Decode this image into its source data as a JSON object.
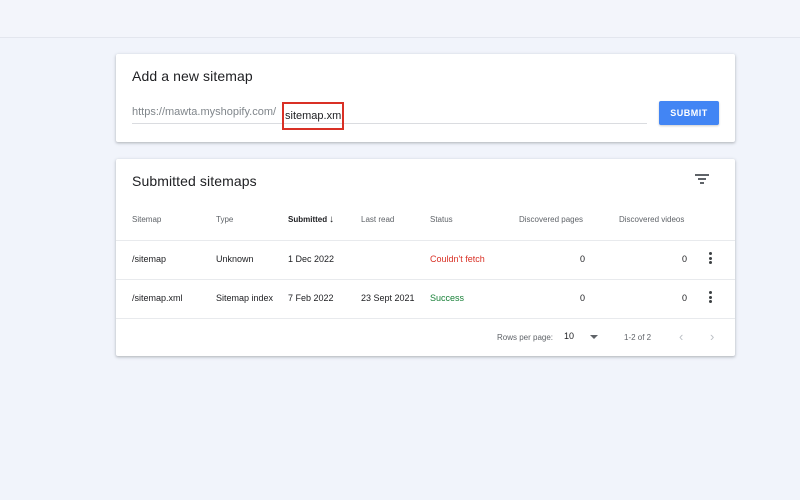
{
  "add_card": {
    "title": "Add a new sitemap",
    "url_prefix": "https://mawta.myshopify.com/",
    "input_value": "sitemap.xml",
    "submit_label": "SUBMIT"
  },
  "submitted_card": {
    "title": "Submitted sitemaps",
    "filter_icon": "filter-icon",
    "columns": {
      "sitemap": "Sitemap",
      "type": "Type",
      "submitted": "Submitted",
      "last_read": "Last read",
      "status": "Status",
      "discovered_pages": "Discovered pages",
      "discovered_videos": "Discovered videos"
    },
    "sort_icon": "↓",
    "rows": [
      {
        "sitemap": "/sitemap",
        "type": "Unknown",
        "submitted": "1 Dec 2022",
        "last_read": "",
        "status": "Couldn't fetch",
        "pages": "0",
        "videos": "0"
      },
      {
        "sitemap": "/sitemap.xml",
        "type": "Sitemap index",
        "submitted": "7 Feb 2022",
        "last_read": "23 Sept 2021",
        "status": "Success",
        "pages": "0",
        "videos": "0"
      }
    ],
    "footer": {
      "rows_per_page_label": "Rows per page:",
      "rows_per_page_value": "10",
      "range": "1-2 of 2",
      "prev": "‹",
      "next": "›"
    }
  },
  "colors": {
    "accent": "#4285f4",
    "error": "#d93025",
    "success": "#188038",
    "highlight_box": "#d93025"
  }
}
